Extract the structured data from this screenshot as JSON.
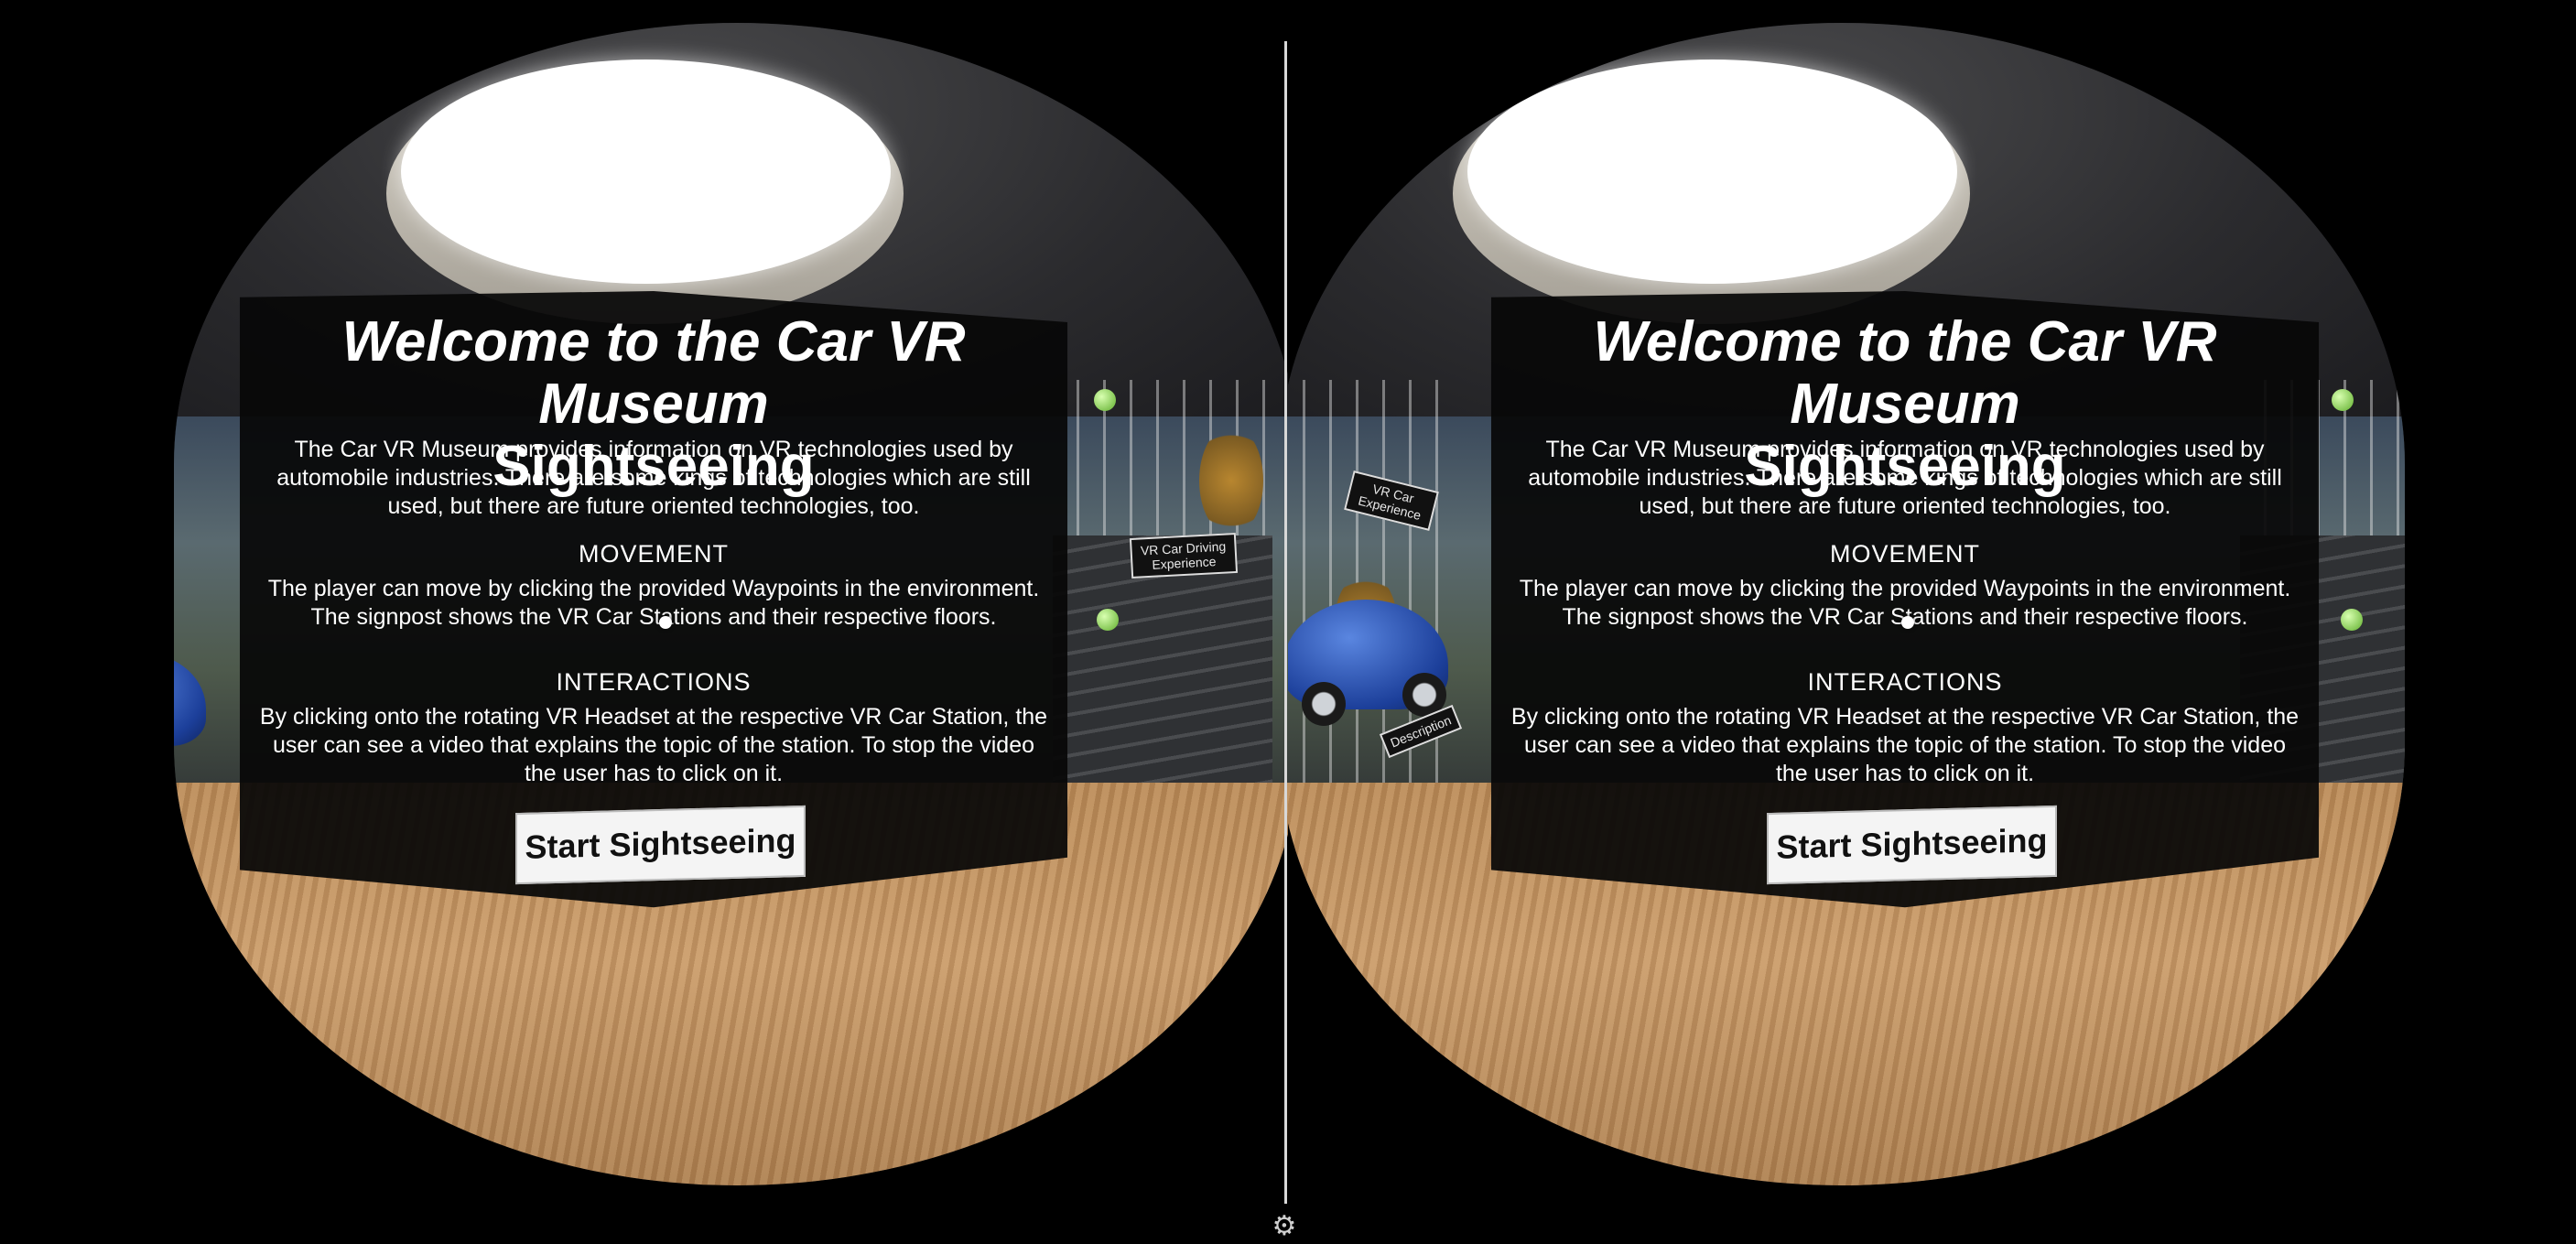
{
  "panel": {
    "title_line1": "Welcome to the Car VR Museum",
    "title_line2": "Sightseeing",
    "intro": "The Car VR Museum provides information on VR technologies used by automobile industries. There are some kings of technologies which are still used, but there are future oriented technologies, too.",
    "movement_heading": "MOVEMENT",
    "movement_text": "The player can move by clicking the provided Waypoints in the environment. The signpost shows the VR Car Stations and their respective floors.",
    "interactions_heading": "INTERACTIONS",
    "interactions_text": "By clicking onto the rotating VR Headset at the respective VR Car Station, the user can see a video that explains the topic of the station. To stop the video the user has to click on it.",
    "button_label": "Start Sightseeing"
  },
  "scene_signs": {
    "driving": "VR Car Driving Experience",
    "experience": "VR Car Experience",
    "description": "Description"
  },
  "settings_icon": "gear-icon"
}
